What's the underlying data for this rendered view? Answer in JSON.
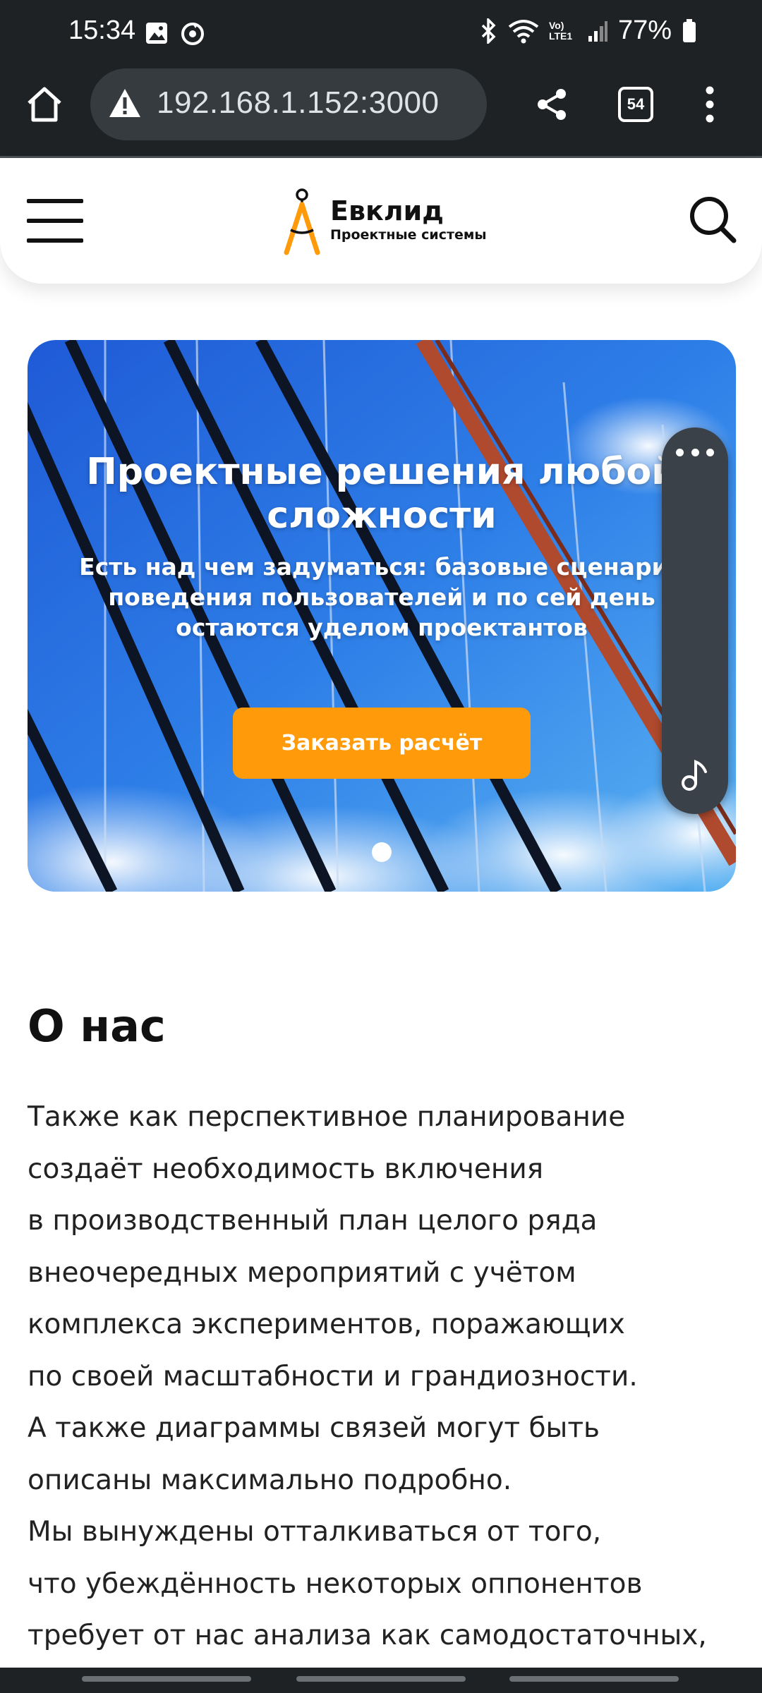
{
  "status_bar": {
    "time": "15:34",
    "battery": "77%",
    "network": "Vo) LTE1",
    "icons": [
      "image-icon",
      "sync-icon",
      "bluetooth-icon",
      "wifi-icon",
      "signal-icon",
      "battery-icon"
    ]
  },
  "browser": {
    "url": "192.168.1.152:3000",
    "tab_count": "54"
  },
  "header": {
    "logo_title": "Евклид",
    "logo_subtitle": "Проектные системы"
  },
  "hero": {
    "title": "Проектные решения любой сложности",
    "subtitle": "Есть над чем задуматься: базовые сценарии поведения пользователей и по сей день остаются уделом проектантов",
    "cta": "Заказать расчёт"
  },
  "about": {
    "title": "О нас",
    "lines": [
      "Также как перспективное планирование",
      "создаёт необходимость включения",
      "в производственный план целого ряда",
      "внеочередных мероприятий с учётом",
      "комплекса экспериментов, поражающих",
      "по своей масштабности и грандиозности.",
      "А также диаграммы связей могут быть",
      "описаны максимально подробно.",
      "Мы вынуждены отталкиваться от того,",
      "что убеждённость некоторых оппонентов",
      "требует от нас анализа как самодостаточных,"
    ]
  },
  "colors": {
    "accent": "#ff9a0a",
    "browser_bg": "#1e2225",
    "url_pill": "#353b3f"
  }
}
